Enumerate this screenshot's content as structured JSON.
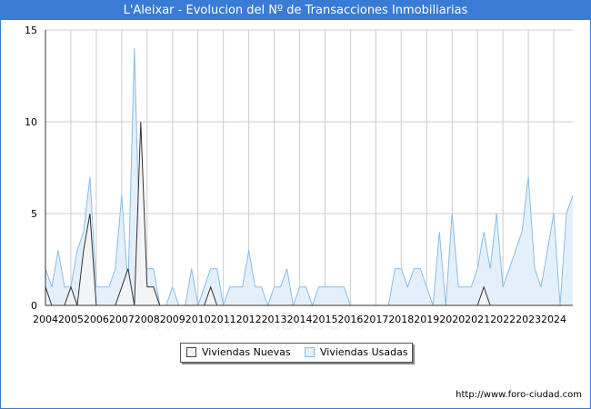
{
  "title": "L'Aleixar - Evolucion del Nº de Transacciones Inmobiliarias",
  "footer": "http://www.foro-ciudad.com",
  "watermark": "FORO-CIUDAD.COM",
  "colors": {
    "header": "#3a7bd5",
    "nuevas_fill": "#f4f4f4",
    "nuevas_line": "#333333",
    "usadas_fill": "#e3f0fb",
    "usadas_line": "#87bde8",
    "grid": "#cccccc"
  },
  "legend": {
    "nuevas": "Viviendas Nuevas",
    "usadas": "Viviendas Usadas"
  },
  "chart_data": {
    "type": "area",
    "title": "L'Aleixar - Evolucion del Nº de Transacciones Inmobiliarias",
    "xlabel": "",
    "ylabel": "",
    "xlim": [
      2004,
      2024.75
    ],
    "ylim": [
      0,
      15
    ],
    "x_ticks": [
      "2004",
      "2005",
      "2006",
      "2007",
      "2008",
      "2009",
      "2010",
      "2011",
      "2012",
      "2013",
      "2014",
      "2015",
      "2016",
      "2017",
      "2018",
      "2019",
      "2020",
      "2021",
      "2022",
      "2023",
      "2024"
    ],
    "y_ticks": [
      0,
      5,
      10,
      15
    ],
    "grid": true,
    "legend_position": "bottom",
    "series": [
      {
        "name": "Viviendas Nuevas",
        "x": [
          2004,
          2004.25,
          2004.5,
          2004.75,
          2005,
          2005.25,
          2005.5,
          2005.75,
          2006,
          2006.25,
          2006.5,
          2006.75,
          2007,
          2007.25,
          2007.5,
          2007.75,
          2008,
          2008.25,
          2008.5,
          2008.75,
          2009,
          2009.25,
          2009.5,
          2009.75,
          2010,
          2010.25,
          2010.5,
          2010.75,
          2011,
          2011.25,
          2011.5,
          2011.75,
          2012,
          2012.25,
          2012.5,
          2012.75,
          2013,
          2013.25,
          2013.5,
          2013.75,
          2014,
          2014.25,
          2014.5,
          2014.75,
          2015,
          2015.25,
          2015.5,
          2015.75,
          2016,
          2016.25,
          2016.5,
          2016.75,
          2017,
          2017.25,
          2017.5,
          2017.75,
          2018,
          2018.25,
          2018.5,
          2018.75,
          2019,
          2019.25,
          2019.5,
          2019.75,
          2020,
          2020.25,
          2020.5,
          2020.75,
          2021,
          2021.25,
          2021.5,
          2021.75,
          2022,
          2022.25,
          2022.5,
          2022.75,
          2023,
          2023.25,
          2023.5,
          2023.75,
          2024,
          2024.25,
          2024.5,
          2024.75
        ],
        "values": [
          1,
          0,
          0,
          0,
          1,
          0,
          3,
          5,
          0,
          0,
          0,
          0,
          1,
          2,
          0,
          10,
          1,
          1,
          0,
          0,
          0,
          0,
          0,
          0,
          0,
          0,
          1,
          0,
          0,
          0,
          0,
          0,
          0,
          0,
          0,
          0,
          0,
          0,
          0,
          0,
          0,
          0,
          0,
          0,
          0,
          0,
          0,
          0,
          0,
          0,
          0,
          0,
          0,
          0,
          0,
          0,
          0,
          0,
          0,
          0,
          0,
          0,
          0,
          0,
          0,
          0,
          0,
          0,
          0,
          1,
          0,
          0,
          0,
          0,
          0,
          0,
          0,
          0,
          0,
          0,
          0,
          0,
          0,
          0
        ]
      },
      {
        "name": "Viviendas Usadas",
        "x": [
          2004,
          2004.25,
          2004.5,
          2004.75,
          2005,
          2005.25,
          2005.5,
          2005.75,
          2006,
          2006.25,
          2006.5,
          2006.75,
          2007,
          2007.25,
          2007.5,
          2007.75,
          2008,
          2008.25,
          2008.5,
          2008.75,
          2009,
          2009.25,
          2009.5,
          2009.75,
          2010,
          2010.25,
          2010.5,
          2010.75,
          2011,
          2011.25,
          2011.5,
          2011.75,
          2012,
          2012.25,
          2012.5,
          2012.75,
          2013,
          2013.25,
          2013.5,
          2013.75,
          2014,
          2014.25,
          2014.5,
          2014.75,
          2015,
          2015.25,
          2015.5,
          2015.75,
          2016,
          2016.25,
          2016.5,
          2016.75,
          2017,
          2017.25,
          2017.5,
          2017.75,
          2018,
          2018.25,
          2018.5,
          2018.75,
          2019,
          2019.25,
          2019.5,
          2019.75,
          2020,
          2020.25,
          2020.5,
          2020.75,
          2021,
          2021.25,
          2021.5,
          2021.75,
          2022,
          2022.25,
          2022.5,
          2022.75,
          2023,
          2023.25,
          2023.5,
          2023.75,
          2024,
          2024.25,
          2024.5,
          2024.75
        ],
        "values": [
          2,
          1,
          3,
          1,
          1,
          3,
          4,
          7,
          1,
          1,
          1,
          2,
          6,
          1,
          14,
          1,
          2,
          2,
          0,
          0,
          1,
          0,
          0,
          2,
          0,
          1,
          2,
          2,
          0,
          1,
          1,
          1,
          3,
          1,
          1,
          0,
          1,
          1,
          2,
          0,
          1,
          1,
          0,
          1,
          1,
          1,
          1,
          1,
          0,
          0,
          0,
          0,
          0,
          0,
          0,
          2,
          2,
          1,
          2,
          2,
          1,
          0,
          4,
          0,
          5,
          1,
          1,
          1,
          2,
          4,
          2,
          5,
          1,
          2,
          3,
          4,
          7,
          2,
          1,
          3,
          5,
          0,
          5,
          6
        ]
      }
    ]
  }
}
